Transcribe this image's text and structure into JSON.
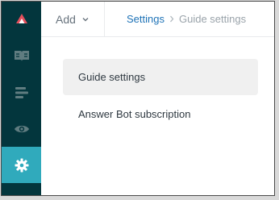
{
  "header": {
    "add_label": "Add",
    "breadcrumb": {
      "parent": "Settings",
      "current": "Guide settings"
    }
  },
  "sidebar": {
    "items": [
      {
        "icon": "zendesk-logo-icon"
      },
      {
        "icon": "guide-book-icon"
      },
      {
        "icon": "arrange-content-icon"
      },
      {
        "icon": "eye-icon"
      },
      {
        "icon": "gear-icon",
        "active": true
      }
    ],
    "accent_color": "#30aabc",
    "background_color": "#03363d",
    "logo_color": "#e34f5c"
  },
  "menu": {
    "items": [
      {
        "label": "Guide settings",
        "active": true
      },
      {
        "label": "Answer Bot subscription",
        "active": false
      }
    ]
  }
}
